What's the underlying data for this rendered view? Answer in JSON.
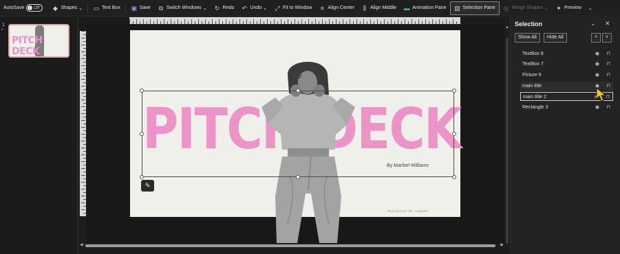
{
  "toolbar": {
    "autosave_label": "AutoSave",
    "autosave_state": "Off",
    "items": [
      {
        "label": "Shapes",
        "icon": "shapes-icon",
        "dropdown": true
      },
      {
        "label": "Text Box",
        "icon": "textbox-icon"
      },
      {
        "label": "Save",
        "icon": "save-icon"
      },
      {
        "label": "Switch Windows",
        "icon": "switch-windows-icon",
        "dropdown": true
      },
      {
        "label": "Redo",
        "icon": "redo-icon"
      },
      {
        "label": "Undo",
        "icon": "undo-icon",
        "dropdown": true
      },
      {
        "label": "Fit to Window",
        "icon": "fit-window-icon"
      },
      {
        "label": "Align Center",
        "icon": "align-center-icon"
      },
      {
        "label": "Align Middle",
        "icon": "align-middle-icon"
      },
      {
        "label": "Animation Pane",
        "icon": "animation-pane-icon"
      },
      {
        "label": "Selection Pane",
        "icon": "selection-pane-icon"
      },
      {
        "label": "Merge Shapes",
        "icon": "merge-shapes-icon",
        "dropdown": true
      },
      {
        "label": "Preview",
        "icon": "preview-icon"
      }
    ]
  },
  "thumbnail": {
    "slide_number": "1",
    "marker": "*",
    "title": "PITCH DECK"
  },
  "slide": {
    "title": "PITCH DECK",
    "byline": "By Maribel Williams",
    "credit": "Photo by Dom Hill - Unsplash"
  },
  "selection_pane": {
    "title": "Selection",
    "show_all": "Show All",
    "hide_all": "Hide All",
    "items": [
      {
        "label": "TextBox 8"
      },
      {
        "label": "TextBox 7"
      },
      {
        "label": "Picture 6"
      },
      {
        "label": "main title"
      },
      {
        "label": "main title 2"
      },
      {
        "label": "Rectangle 3"
      }
    ]
  },
  "colors": {
    "accent_pink": "#ec93c8",
    "slide_bg": "#eff0ea",
    "app_bg": "#1c1c1c"
  }
}
